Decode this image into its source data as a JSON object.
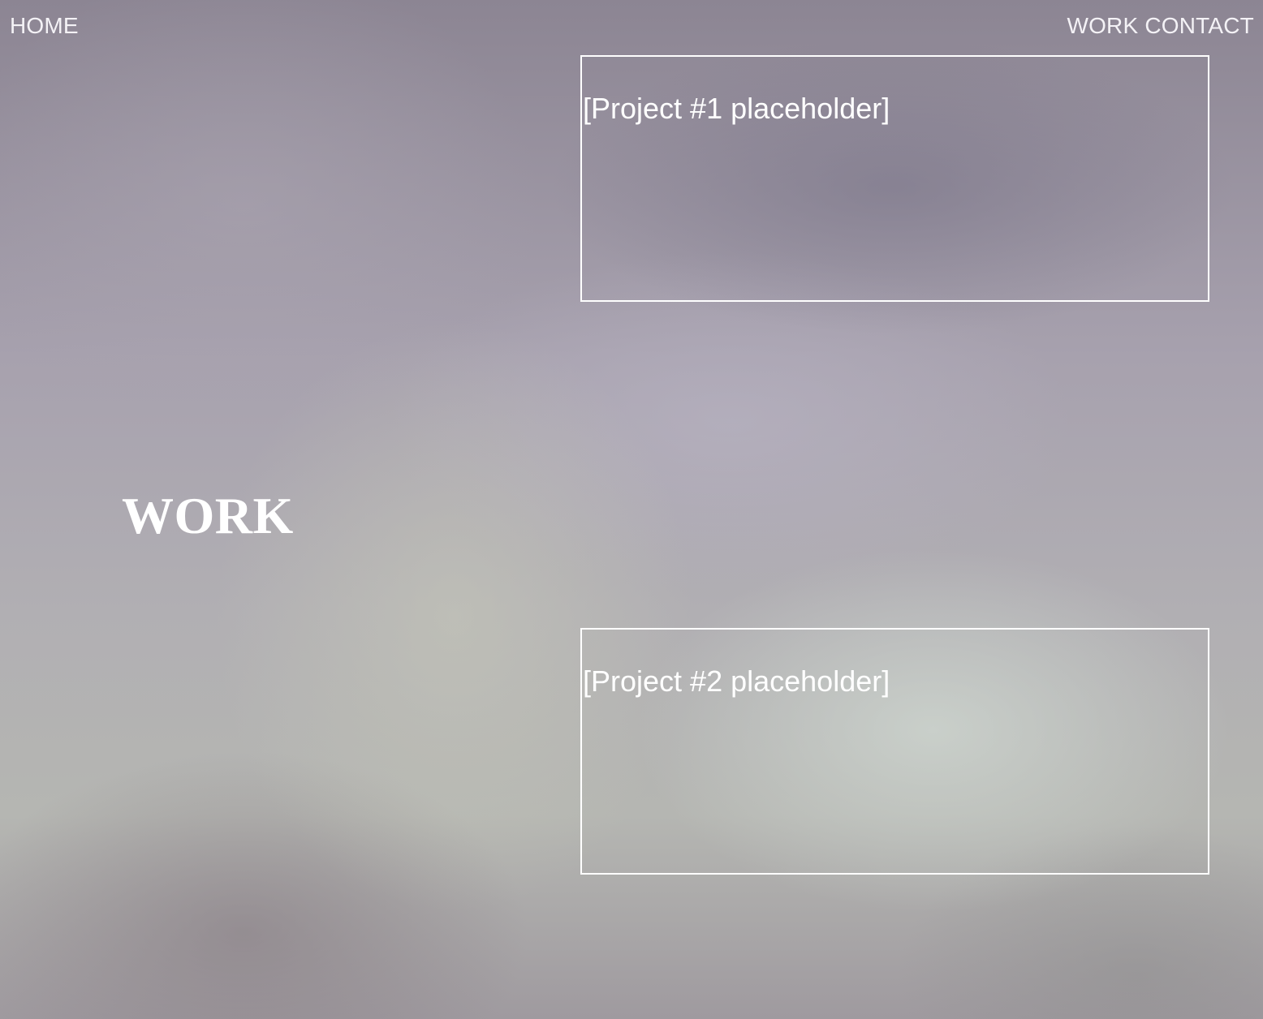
{
  "nav": {
    "home_label": "HOME",
    "work_label": "WORK",
    "contact_label": "CONTACT"
  },
  "page": {
    "title": "WORK"
  },
  "projects": [
    {
      "label": "[Project #1 placeholder]"
    },
    {
      "label": "[Project #2 placeholder]"
    }
  ],
  "colors": {
    "text": "#ffffff",
    "card_border": "#ffffff",
    "background_tone": "#a09aa6"
  }
}
